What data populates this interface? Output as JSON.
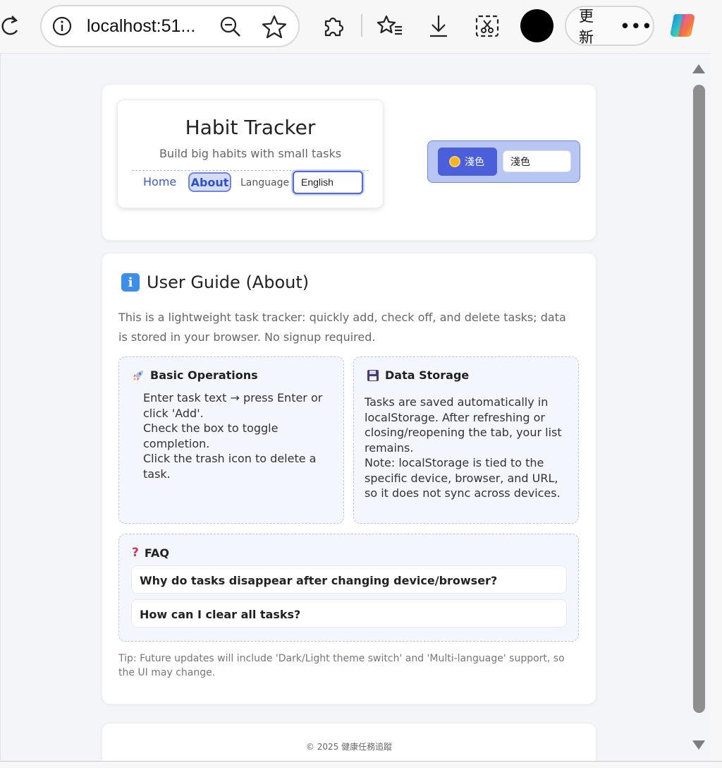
{
  "browser": {
    "url": "localhost:51...",
    "update_label": "更新",
    "more_label": "•••"
  },
  "header": {
    "title": "Habit Tracker",
    "subtitle": "Build big habits with small tasks",
    "nav": {
      "home": "Home",
      "about": "About",
      "language_label": "Language"
    },
    "language_value": "English",
    "theme": {
      "button_label": "淺色",
      "select_value": "淺色"
    }
  },
  "guide": {
    "title": "User Guide (About)",
    "intro": "This is a lightweight task tracker: quickly add, check off, and delete tasks; data is stored in your browser. No signup required.",
    "basic": {
      "title": "Basic Operations",
      "lines": [
        "Enter task text → press Enter or click 'Add'.",
        "Check the box to toggle completion.",
        "Click the trash icon to delete a task."
      ]
    },
    "storage": {
      "title": "Data Storage",
      "lines": [
        "Tasks are saved automatically in localStorage. After refreshing or closing/reopening the tab, your list remains.",
        "Note: localStorage is tied to the specific device, browser, and URL, so it does not sync across devices."
      ]
    },
    "faq": {
      "title": "FAQ",
      "items": [
        "Why do tasks disappear after changing device/browser?",
        "How can I clear all tasks?"
      ]
    },
    "tip": "Tip: Future updates will include 'Dark/Light theme switch' and 'Multi-language' support, so the UI may change."
  },
  "footer": {
    "text": "© 2025 健康任務追蹤"
  }
}
